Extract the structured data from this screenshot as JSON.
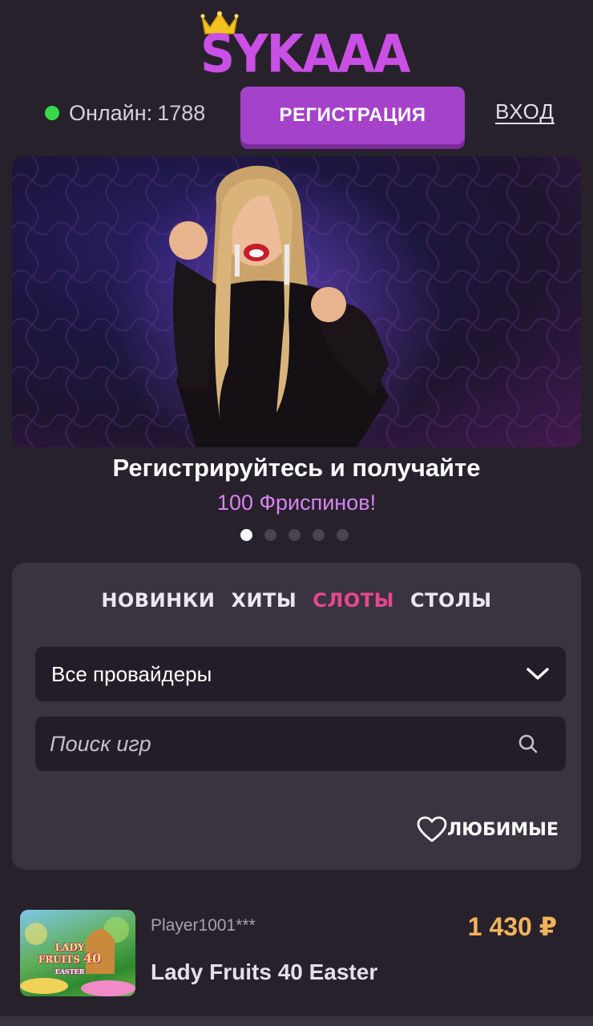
{
  "brand": {
    "logo_text": "SYKAAA",
    "accent": "#c94fe5"
  },
  "header": {
    "online_label": "Онлайн:",
    "online_count": "1788",
    "register_label": "РЕГИСТРАЦИЯ",
    "login_label": "ВХОД"
  },
  "promo": {
    "title": "Регистрируйтесь и получайте",
    "subtitle": "100 Фриспинов!",
    "slides_total": 5,
    "active_slide": 1
  },
  "games_panel": {
    "tabs": [
      {
        "label": "НОВИНКИ",
        "active": false
      },
      {
        "label": "ХИТЫ",
        "active": false
      },
      {
        "label": "СЛОТЫ",
        "active": true
      },
      {
        "label": "СТОЛЫ",
        "active": false
      }
    ],
    "provider_select": "Все провайдеры",
    "search_placeholder": "Поиск игр",
    "favorites_label": "ЛЮБИМЫЕ"
  },
  "recent_win": {
    "player": "Player1001***",
    "amount": "1 430 ₽",
    "game": "Lady Fruits 40 Easter",
    "thumb_text_main": "LADY FRUITS",
    "thumb_text_num": "40",
    "thumb_text_sub": "EASTER"
  },
  "colors": {
    "background": "#27212c",
    "panel": "#3a3340",
    "register_button": "#a442c9",
    "active_tab": "#e6488f",
    "online_dot": "#36d94a",
    "win_amount": "#f0b45a"
  }
}
